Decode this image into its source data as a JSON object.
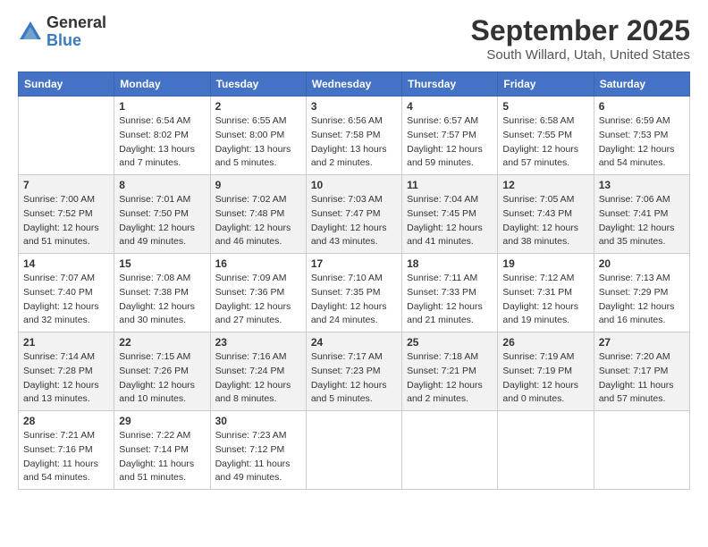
{
  "header": {
    "logo_general": "General",
    "logo_blue": "Blue",
    "title": "September 2025",
    "subtitle": "South Willard, Utah, United States"
  },
  "days_of_week": [
    "Sunday",
    "Monday",
    "Tuesday",
    "Wednesday",
    "Thursday",
    "Friday",
    "Saturday"
  ],
  "weeks": [
    [
      {
        "day": "",
        "info": ""
      },
      {
        "day": "1",
        "info": "Sunrise: 6:54 AM\nSunset: 8:02 PM\nDaylight: 13 hours\nand 7 minutes."
      },
      {
        "day": "2",
        "info": "Sunrise: 6:55 AM\nSunset: 8:00 PM\nDaylight: 13 hours\nand 5 minutes."
      },
      {
        "day": "3",
        "info": "Sunrise: 6:56 AM\nSunset: 7:58 PM\nDaylight: 13 hours\nand 2 minutes."
      },
      {
        "day": "4",
        "info": "Sunrise: 6:57 AM\nSunset: 7:57 PM\nDaylight: 12 hours\nand 59 minutes."
      },
      {
        "day": "5",
        "info": "Sunrise: 6:58 AM\nSunset: 7:55 PM\nDaylight: 12 hours\nand 57 minutes."
      },
      {
        "day": "6",
        "info": "Sunrise: 6:59 AM\nSunset: 7:53 PM\nDaylight: 12 hours\nand 54 minutes."
      }
    ],
    [
      {
        "day": "7",
        "info": "Sunrise: 7:00 AM\nSunset: 7:52 PM\nDaylight: 12 hours\nand 51 minutes."
      },
      {
        "day": "8",
        "info": "Sunrise: 7:01 AM\nSunset: 7:50 PM\nDaylight: 12 hours\nand 49 minutes."
      },
      {
        "day": "9",
        "info": "Sunrise: 7:02 AM\nSunset: 7:48 PM\nDaylight: 12 hours\nand 46 minutes."
      },
      {
        "day": "10",
        "info": "Sunrise: 7:03 AM\nSunset: 7:47 PM\nDaylight: 12 hours\nand 43 minutes."
      },
      {
        "day": "11",
        "info": "Sunrise: 7:04 AM\nSunset: 7:45 PM\nDaylight: 12 hours\nand 41 minutes."
      },
      {
        "day": "12",
        "info": "Sunrise: 7:05 AM\nSunset: 7:43 PM\nDaylight: 12 hours\nand 38 minutes."
      },
      {
        "day": "13",
        "info": "Sunrise: 7:06 AM\nSunset: 7:41 PM\nDaylight: 12 hours\nand 35 minutes."
      }
    ],
    [
      {
        "day": "14",
        "info": "Sunrise: 7:07 AM\nSunset: 7:40 PM\nDaylight: 12 hours\nand 32 minutes."
      },
      {
        "day": "15",
        "info": "Sunrise: 7:08 AM\nSunset: 7:38 PM\nDaylight: 12 hours\nand 30 minutes."
      },
      {
        "day": "16",
        "info": "Sunrise: 7:09 AM\nSunset: 7:36 PM\nDaylight: 12 hours\nand 27 minutes."
      },
      {
        "day": "17",
        "info": "Sunrise: 7:10 AM\nSunset: 7:35 PM\nDaylight: 12 hours\nand 24 minutes."
      },
      {
        "day": "18",
        "info": "Sunrise: 7:11 AM\nSunset: 7:33 PM\nDaylight: 12 hours\nand 21 minutes."
      },
      {
        "day": "19",
        "info": "Sunrise: 7:12 AM\nSunset: 7:31 PM\nDaylight: 12 hours\nand 19 minutes."
      },
      {
        "day": "20",
        "info": "Sunrise: 7:13 AM\nSunset: 7:29 PM\nDaylight: 12 hours\nand 16 minutes."
      }
    ],
    [
      {
        "day": "21",
        "info": "Sunrise: 7:14 AM\nSunset: 7:28 PM\nDaylight: 12 hours\nand 13 minutes."
      },
      {
        "day": "22",
        "info": "Sunrise: 7:15 AM\nSunset: 7:26 PM\nDaylight: 12 hours\nand 10 minutes."
      },
      {
        "day": "23",
        "info": "Sunrise: 7:16 AM\nSunset: 7:24 PM\nDaylight: 12 hours\nand 8 minutes."
      },
      {
        "day": "24",
        "info": "Sunrise: 7:17 AM\nSunset: 7:23 PM\nDaylight: 12 hours\nand 5 minutes."
      },
      {
        "day": "25",
        "info": "Sunrise: 7:18 AM\nSunset: 7:21 PM\nDaylight: 12 hours\nand 2 minutes."
      },
      {
        "day": "26",
        "info": "Sunrise: 7:19 AM\nSunset: 7:19 PM\nDaylight: 12 hours\nand 0 minutes."
      },
      {
        "day": "27",
        "info": "Sunrise: 7:20 AM\nSunset: 7:17 PM\nDaylight: 11 hours\nand 57 minutes."
      }
    ],
    [
      {
        "day": "28",
        "info": "Sunrise: 7:21 AM\nSunset: 7:16 PM\nDaylight: 11 hours\nand 54 minutes."
      },
      {
        "day": "29",
        "info": "Sunrise: 7:22 AM\nSunset: 7:14 PM\nDaylight: 11 hours\nand 51 minutes."
      },
      {
        "day": "30",
        "info": "Sunrise: 7:23 AM\nSunset: 7:12 PM\nDaylight: 11 hours\nand 49 minutes."
      },
      {
        "day": "",
        "info": ""
      },
      {
        "day": "",
        "info": ""
      },
      {
        "day": "",
        "info": ""
      },
      {
        "day": "",
        "info": ""
      }
    ]
  ]
}
